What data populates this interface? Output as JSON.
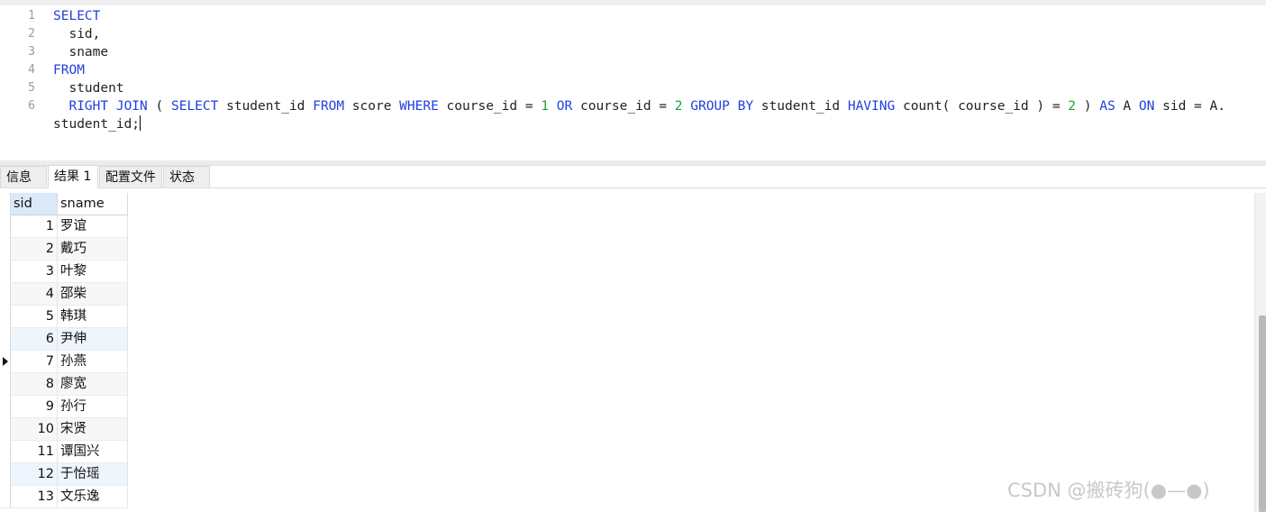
{
  "editor": {
    "lines": [
      {
        "num": "1",
        "tokens": [
          {
            "t": "SELECT",
            "k": "kw"
          }
        ]
      },
      {
        "num": "2",
        "tokens": [
          {
            "t": "  sid,",
            "k": ""
          }
        ]
      },
      {
        "num": "3",
        "tokens": [
          {
            "t": "  sname",
            "k": ""
          }
        ]
      },
      {
        "num": "4",
        "tokens": [
          {
            "t": "FROM",
            "k": "kw"
          }
        ]
      },
      {
        "num": "5",
        "tokens": [
          {
            "t": "  student",
            "k": ""
          }
        ]
      },
      {
        "num": "6",
        "tokens": [
          {
            "t": "  ",
            "k": ""
          },
          {
            "t": "RIGHT JOIN",
            "k": "kw"
          },
          {
            "t": " ( ",
            "k": ""
          },
          {
            "t": "SELECT",
            "k": "kw"
          },
          {
            "t": " student_id ",
            "k": ""
          },
          {
            "t": "FROM",
            "k": "kw"
          },
          {
            "t": " score ",
            "k": ""
          },
          {
            "t": "WHERE",
            "k": "kw"
          },
          {
            "t": " course_id = ",
            "k": ""
          },
          {
            "t": "1",
            "k": "num"
          },
          {
            "t": " ",
            "k": ""
          },
          {
            "t": "OR",
            "k": "kw"
          },
          {
            "t": " course_id = ",
            "k": ""
          },
          {
            "t": "2",
            "k": "num"
          },
          {
            "t": " ",
            "k": ""
          },
          {
            "t": "GROUP BY",
            "k": "kw"
          },
          {
            "t": " student_id ",
            "k": ""
          },
          {
            "t": "HAVING",
            "k": "kw"
          },
          {
            "t": " count( course_id ) = ",
            "k": ""
          },
          {
            "t": "2",
            "k": "num"
          },
          {
            "t": " ) ",
            "k": ""
          },
          {
            "t": "AS",
            "k": "kw"
          },
          {
            "t": " A ",
            "k": ""
          },
          {
            "t": "ON",
            "k": "kw"
          },
          {
            "t": " sid = A.",
            "k": ""
          }
        ]
      },
      {
        "num": "",
        "tokens": [
          {
            "t": "student_id;",
            "k": ""
          }
        ],
        "caret": true
      }
    ]
  },
  "tabs": [
    {
      "label": "信息",
      "active": false
    },
    {
      "label": "结果 1",
      "active": true
    },
    {
      "label": "配置文件",
      "active": false
    },
    {
      "label": "状态",
      "active": false
    }
  ],
  "result": {
    "columns": [
      "sid",
      "sname"
    ],
    "rows": [
      [
        "1",
        "罗谊"
      ],
      [
        "2",
        "戴巧"
      ],
      [
        "3",
        "叶黎"
      ],
      [
        "4",
        "邵柴"
      ],
      [
        "5",
        "韩琪"
      ],
      [
        "6",
        "尹伸"
      ],
      [
        "7",
        "孙燕"
      ],
      [
        "8",
        "廖宽"
      ],
      [
        "9",
        "孙行"
      ],
      [
        "10",
        "宋贤"
      ],
      [
        "11",
        "谭国兴"
      ],
      [
        "12",
        "于怡瑶"
      ],
      [
        "13",
        "文乐逸"
      ]
    ],
    "current_row_index": 6
  },
  "colors": {
    "keyword": "#1f3fe0",
    "number": "#1aa531",
    "header_selected": "#dbe9f9",
    "row_highlight": "#eef5fd"
  },
  "watermark": "CSDN @搬砖狗(●—●)"
}
